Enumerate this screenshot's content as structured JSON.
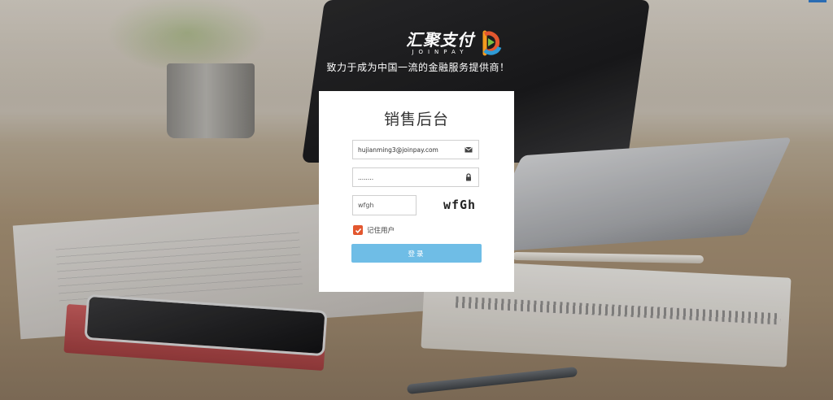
{
  "brand": {
    "name_cn": "汇聚支付",
    "name_en": "JOINPAY",
    "slogan": "致力于成为中国一流的金融服务提供商！",
    "logo_icon": "joinpay-logo-icon"
  },
  "login": {
    "title": "销售后台",
    "email": {
      "value": "hujianming3@joinpay.com",
      "icon": "envelope-icon"
    },
    "password": {
      "value": "........",
      "icon": "lock-icon"
    },
    "captcha": {
      "value": "wfgh",
      "image_text": "wfGh"
    },
    "remember": {
      "label": "记住用户",
      "checked": true
    },
    "submit_label": "登录"
  },
  "colors": {
    "accent_button": "#6fbde6",
    "checkbox": "#e3572f",
    "panel_bg": "#ffffff"
  }
}
